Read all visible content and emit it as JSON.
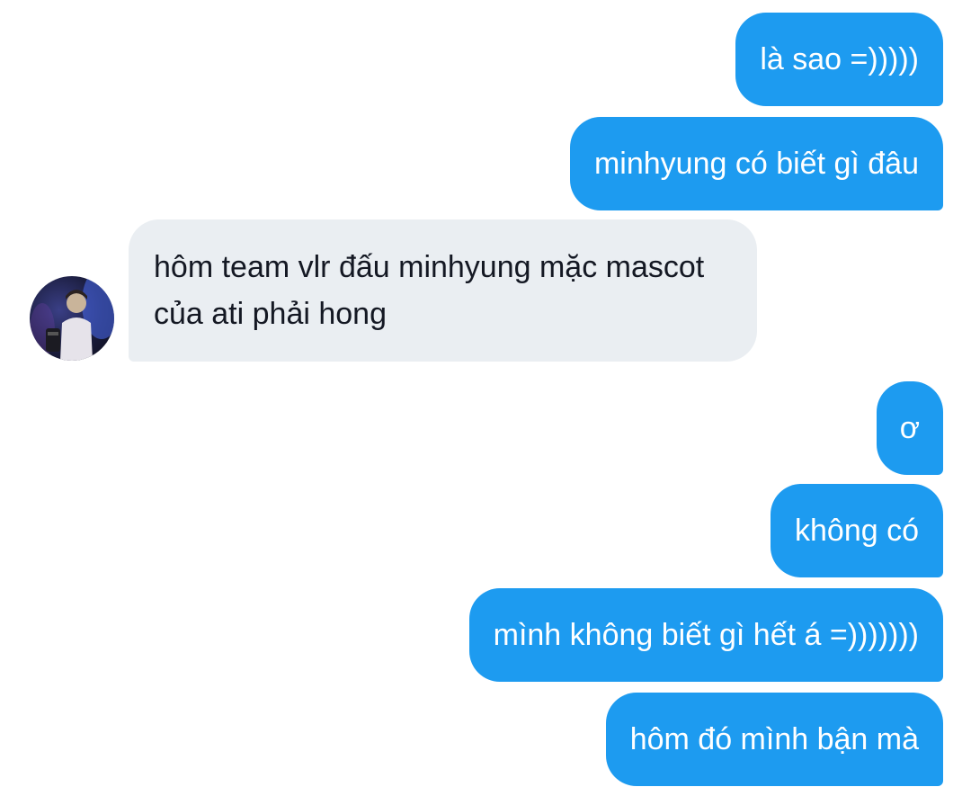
{
  "conversation": {
    "messages": [
      {
        "sender": "me",
        "text": "là sao =)))))"
      },
      {
        "sender": "me",
        "text": "minhyung có biết gì đâu"
      },
      {
        "sender": "other",
        "text": "hôm team vlr đấu minhyung mặc mascot của ati phải hong"
      },
      {
        "sender": "me",
        "text": "ơ"
      },
      {
        "sender": "me",
        "text": "không có"
      },
      {
        "sender": "me",
        "text": "mình không biết gì hết á =)))))))"
      },
      {
        "sender": "me",
        "text": "hôm đó mình bận mà"
      }
    ]
  },
  "colors": {
    "sent_bubble": "#1d9bf0",
    "received_bubble": "#eaeef2",
    "sent_text": "#ffffff",
    "received_text": "#141823"
  }
}
